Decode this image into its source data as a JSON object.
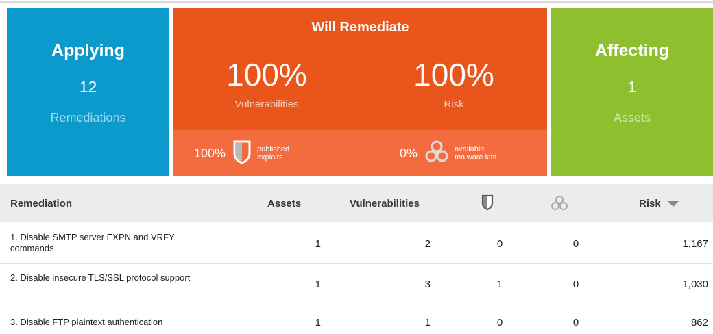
{
  "cards": {
    "applying": {
      "title": "Applying",
      "count": "12",
      "label": "Remediations"
    },
    "will_remediate": {
      "title": "Will Remediate",
      "vuln_percent": "100%",
      "vuln_label": "Vulnerabilities",
      "risk_percent": "100%",
      "risk_label": "Risk",
      "exploits_percent": "100%",
      "exploits_label_line1": "published",
      "exploits_label_line2": "exploits",
      "malware_percent": "0%",
      "malware_label_line1": "available",
      "malware_label_line2": "malware kits"
    },
    "affecting": {
      "title": "Affecting",
      "count": "1",
      "label": "Assets"
    }
  },
  "colors": {
    "applying": "#0b9acb",
    "will_remediate": "#ea551b",
    "will_remediate_bottom": "#f26c3f",
    "affecting": "#8dbf2e"
  },
  "table": {
    "headers": {
      "remediation": "Remediation",
      "assets": "Assets",
      "vulnerabilities": "Vulnerabilities",
      "exploits_icon": "shield-icon",
      "malware_icon": "biohazard-icon",
      "risk": "Risk"
    },
    "sort_icon": "sort-desc-caret-icon",
    "rows": [
      {
        "label_line1": "1. Disable SMTP server EXPN and VRFY",
        "label_line2": "commands",
        "assets": "1",
        "vulnerabilities": "2",
        "exploits": "0",
        "malware": "0",
        "risk": "1,167"
      },
      {
        "label_line1": "2. Disable insecure TLS/SSL protocol support",
        "label_line2": "",
        "assets": "1",
        "vulnerabilities": "3",
        "exploits": "1",
        "malware": "0",
        "risk": "1,030"
      },
      {
        "label_line1": "3. Disable FTP plaintext authentication",
        "label_line2": "",
        "assets": "1",
        "vulnerabilities": "1",
        "exploits": "0",
        "malware": "0",
        "risk": "862"
      }
    ]
  }
}
